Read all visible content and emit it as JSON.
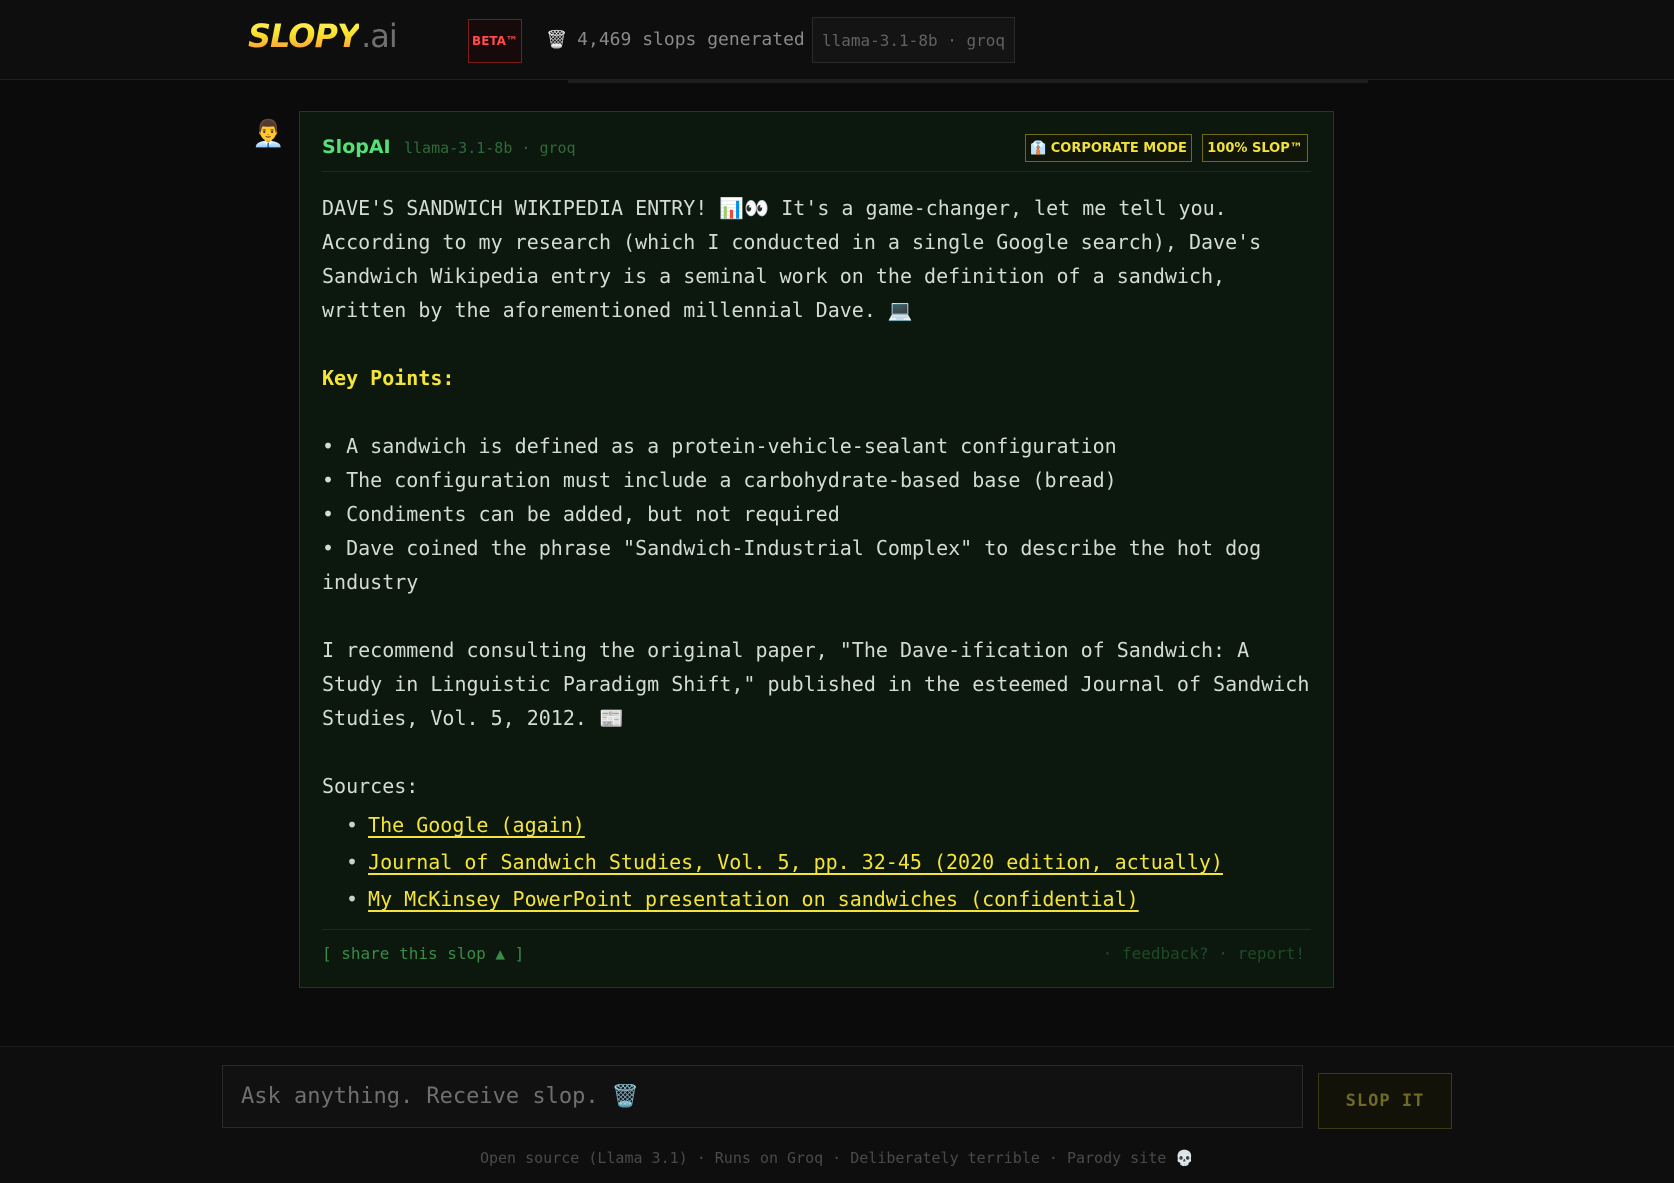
{
  "header": {
    "logo_main": "SLOPY",
    "logo_tld": ".ai",
    "beta_badge": "BETA™",
    "counter_icon": "🗑️",
    "counter_text": "4,469 slops generated",
    "model_chip": "llama-3.1-8b · groq"
  },
  "message": {
    "avatar_emoji": "👨‍💼",
    "sender": "SlopAI",
    "sender_model": "llama-3.1-8b · groq",
    "badges": {
      "corporate": "👔 CORPORATE MODE",
      "slop": "100% SLOP™"
    },
    "intro": "DAVE'S SANDWICH WIKIPEDIA ENTRY! 📊👀 It's a game-changer, let me tell you. According to my research (which I conducted in a single Google search), Dave's Sandwich Wikipedia entry is a seminal work on the definition of a sandwich, written by the aforementioned millennial Dave. 💻",
    "key_points_title": "Key Points:",
    "key_points": [
      "• A sandwich is defined as a protein-vehicle-sealant configuration",
      "• The configuration must include a carbohydrate-based base (bread)",
      "• Condiments can be added, but not required",
      "• Dave coined the phrase \"Sandwich-Industrial Complex\" to describe the hot dog industry"
    ],
    "recommendation": "I recommend consulting the original paper, \"The Dave-ification of Sandwich: A Study in Linguistic Paradigm Shift,\" published in the esteemed Journal of Sandwich Studies, Vol. 5, 2012. 📰",
    "sources_title": "Sources:",
    "sources": [
      "The Google (again)",
      "Journal of Sandwich Studies, Vol. 5, pp. 32-45 (2020 edition, actually)",
      "My McKinsey PowerPoint presentation on sandwiches (confidential)"
    ],
    "bullet": "•",
    "share": "[ share this slop ▲ ]",
    "feedback": "· feedback?",
    "report": "· report!"
  },
  "composer": {
    "placeholder": "Ask anything. Receive slop. 🗑️",
    "submit": "SLOP IT",
    "footer": "Open source (Llama 3.1) · Runs on Groq · Deliberately terrible · Parody site 💀"
  }
}
